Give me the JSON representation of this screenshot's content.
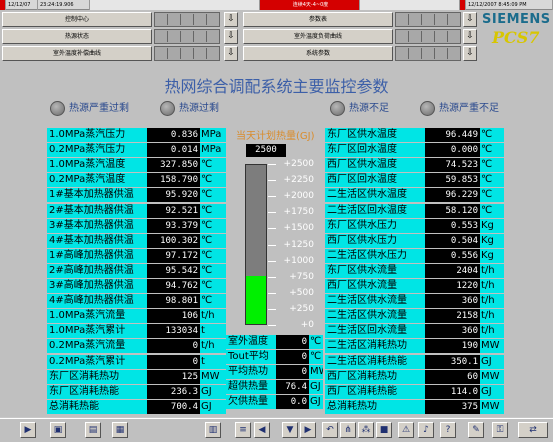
{
  "topbar": {
    "date1": "12/12/07",
    "time1": "23:24:19.906",
    "center": "连续4天-4~0度",
    "right_datetime": "12/12/2007 8:45:09 PM"
  },
  "nav": {
    "left": [
      "控制中心",
      "热源状态",
      "室外温度补偿曲线"
    ],
    "right": [
      "参数表",
      "室外温度负荷曲线",
      "系统参数"
    ]
  },
  "logo": {
    "brand": "SIEMENS",
    "product": "PCS7"
  },
  "title": "热网综合调配系统主要监控参数",
  "status": [
    "热源严重过剩",
    "热源过剩",
    "热源不足",
    "热源严重不足"
  ],
  "left_rows": [
    {
      "label": "1.0MPa蒸汽压力",
      "value": "0.836",
      "unit": "MPa"
    },
    {
      "label": "0.2MPa蒸汽压力",
      "value": "0.014",
      "unit": "MPa"
    },
    {
      "label": "1.0MPa蒸汽温度",
      "value": "327.850",
      "unit": "℃"
    },
    {
      "label": "0.2MPa蒸汽温度",
      "value": "158.790",
      "unit": "℃"
    },
    {
      "label": "1#基本加热器供温",
      "value": "95.920",
      "unit": "℃"
    },
    {
      "label": "2#基本加热器供温",
      "value": "92.521",
      "unit": "℃"
    },
    {
      "label": "3#基本加热器供温",
      "value": "93.379",
      "unit": "℃"
    },
    {
      "label": "4#基本加热器供温",
      "value": "100.302",
      "unit": "℃"
    },
    {
      "label": "1#高峰加热器供温",
      "value": "97.172",
      "unit": "℃"
    },
    {
      "label": "2#高峰加热器供温",
      "value": "95.542",
      "unit": "℃"
    },
    {
      "label": "3#高峰加热器供温",
      "value": "94.762",
      "unit": "℃"
    },
    {
      "label": "4#高峰加热器供温",
      "value": "98.801",
      "unit": "℃"
    },
    {
      "label": "1.0MPa蒸汽流量",
      "value": "106",
      "unit": "t/h"
    },
    {
      "label": "1.0MPa蒸汽累计",
      "value": "133034",
      "unit": "t"
    },
    {
      "label": "0.2MPa蒸汽流量",
      "value": "0",
      "unit": "t/h"
    },
    {
      "label": "0.2MPa蒸汽累计",
      "value": "0",
      "unit": "t"
    },
    {
      "label": "东厂区消耗热功",
      "value": "125",
      "unit": "MW"
    },
    {
      "label": "东厂区消耗热能",
      "value": "236.3",
      "unit": "GJ"
    },
    {
      "label": "总消耗热能",
      "value": "700.4",
      "unit": "GJ"
    }
  ],
  "mid_rows": [
    {
      "label": "室外温度",
      "value": "0",
      "unit": "℃"
    },
    {
      "label": "Tout平均",
      "value": "0",
      "unit": "℃"
    },
    {
      "label": "平均热功",
      "value": "0",
      "unit": "MW"
    },
    {
      "label": "超供热量",
      "value": "76.4",
      "unit": "GJ"
    },
    {
      "label": "欠供热量",
      "value": "0.0",
      "unit": "GJ"
    }
  ],
  "right_rows": [
    {
      "label": "东厂区供水温度",
      "value": "96.449",
      "unit": "℃"
    },
    {
      "label": "东厂区回水温度",
      "value": "0.000",
      "unit": "℃"
    },
    {
      "label": "西厂区供水温度",
      "value": "74.523",
      "unit": "℃"
    },
    {
      "label": "西厂区回水温度",
      "value": "59.853",
      "unit": "℃"
    },
    {
      "label": "二生活区供水温度",
      "value": "96.229",
      "unit": "℃"
    },
    {
      "label": "二生活区回水温度",
      "value": "58.120",
      "unit": "℃"
    },
    {
      "label": "东厂区供水压力",
      "value": "0.553",
      "unit": "Kg"
    },
    {
      "label": "西厂区供水压力",
      "value": "0.504",
      "unit": "Kg"
    },
    {
      "label": "二生活区供水压力",
      "value": "0.556",
      "unit": "Kg"
    },
    {
      "label": "东厂区供水流量",
      "value": "2404",
      "unit": "t/h"
    },
    {
      "label": "西厂区供水流量",
      "value": "1220",
      "unit": "t/h"
    },
    {
      "label": "二生活区供水流量",
      "value": "360",
      "unit": "t/h"
    },
    {
      "label": "二生活区供水流量",
      "value": "2158",
      "unit": "t/h"
    },
    {
      "label": "二生活区回水流量",
      "value": "360",
      "unit": "t/h"
    },
    {
      "label": "二生活区消耗热功",
      "value": "190",
      "unit": "MW"
    },
    {
      "label": "二生活区消耗热能",
      "value": "350.1",
      "unit": "GJ"
    },
    {
      "label": "西厂区消耗热功",
      "value": "60",
      "unit": "MW"
    },
    {
      "label": "西厂区消耗热能",
      "value": "114.0",
      "unit": "GJ"
    },
    {
      "label": "总消耗热功",
      "value": "375",
      "unit": "MW"
    }
  ],
  "gauge": {
    "title": "当天计划热量(GJ)",
    "value": "2500",
    "max": 2500,
    "level": 750,
    "ticks": [
      "+2500",
      "+2250",
      "+2000",
      "+1750",
      "+1500",
      "+1250",
      "+1000",
      "+750",
      "+500",
      "+250",
      "+0"
    ]
  }
}
